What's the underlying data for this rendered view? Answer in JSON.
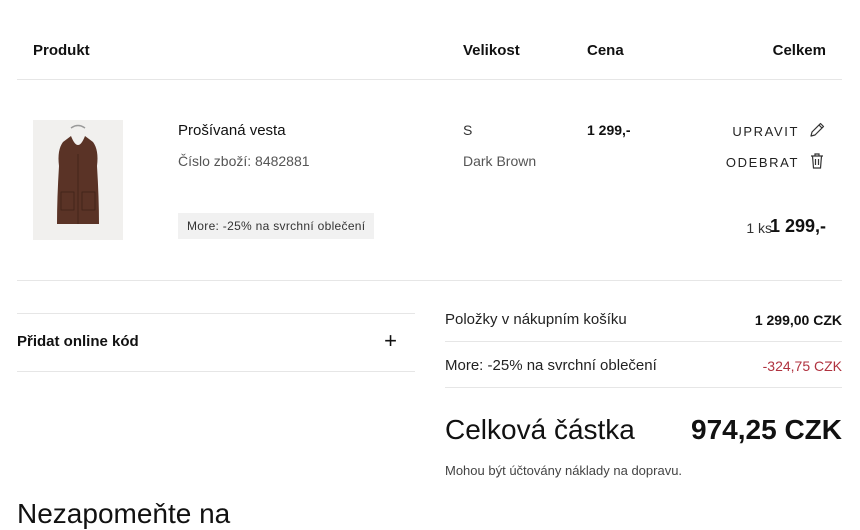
{
  "table_header": {
    "product": "Produkt",
    "size": "Velikost",
    "price": "Cena",
    "total": "Celkem"
  },
  "item": {
    "name": "Prošívaná vesta",
    "sku": "Číslo zboží: 8482881",
    "promo": "More: -25% na svrchní oblečení",
    "size": "S",
    "color": "Dark Brown",
    "price": "1 299,-",
    "edit_label": "UPRAVIT",
    "remove_label": "ODEBRAT",
    "quantity": "1 ks",
    "line_total": "1 299,-"
  },
  "promo_code": {
    "label": "Přidat online kód",
    "toggle": "+"
  },
  "summary": {
    "items_label": "Položky v nákupním košíku",
    "items_value": "1 299,00 CZK",
    "discount_label": "More: -25% na svrchní oblečení",
    "discount_value": "-324,75 CZK",
    "total_label": "Celková částka",
    "total_value": "974,25 CZK",
    "shipping_note": "Mohou být účtovány náklady na dopravu."
  },
  "reminder_heading": "Nezapomeňte na",
  "colors": {
    "discount": "#b0323f",
    "vest": "#5a3326",
    "thumb_bg": "#f1f0ee"
  },
  "icons": {
    "edit": "pencil-icon",
    "remove": "trash-icon"
  }
}
